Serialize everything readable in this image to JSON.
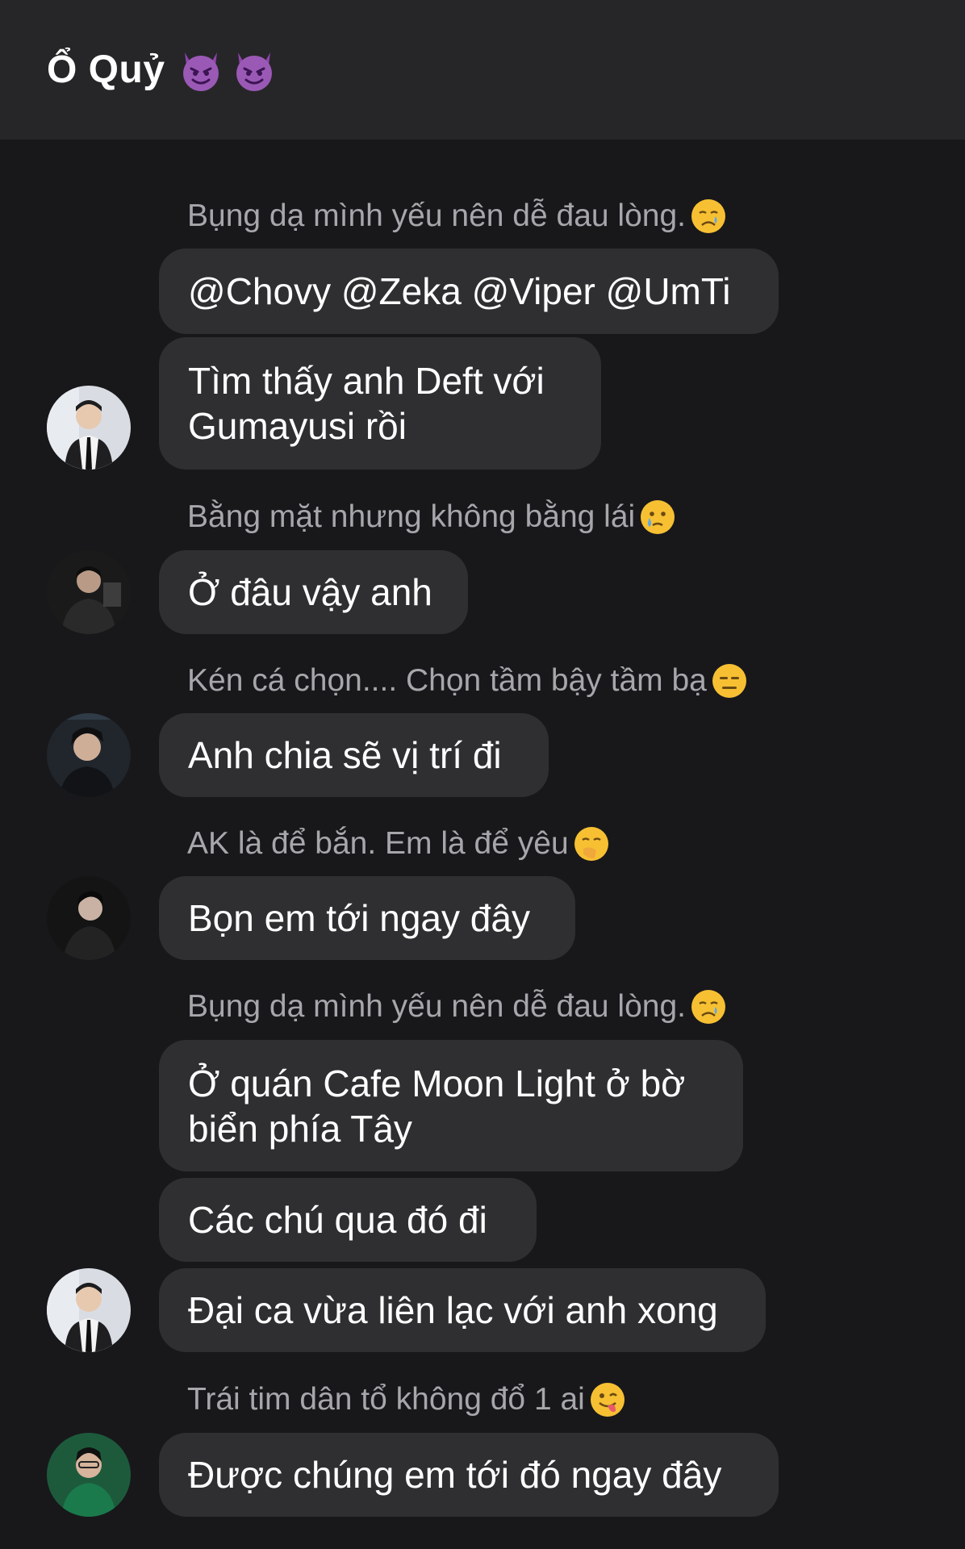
{
  "header": {
    "title": "Ổ Quỷ",
    "icons": [
      "devil-emoji-icon",
      "devil-emoji-icon"
    ]
  },
  "messages": [
    {
      "sender": "Bụng dạ mình yếu nên dễ đau lòng.",
      "sender_emoji": "crying-face-icon",
      "text": "@Chovy @Zeka @Viper @UmTi"
    },
    {
      "text": "Tìm thấy anh Deft với Gumayusi rồi"
    },
    {
      "sender": "Bằng mặt nhưng không bằng lái ",
      "sender_emoji": "sad-tear-face-icon",
      "text": "Ở đâu vậy anh"
    },
    {
      "sender": "Kén cá chọn.... Chọn tầm bậy tầm bạ",
      "sender_emoji": "expressionless-face-icon",
      "text": "Anh chia sẽ vị trí đi"
    },
    {
      "sender": "AK là để bắn. Em là để yêu",
      "sender_emoji": "face-with-hand-over-mouth-icon",
      "text": "Bọn em tới ngay đây"
    },
    {
      "sender": "Bụng dạ mình yếu nên dễ đau lòng.",
      "sender_emoji": "crying-face-icon",
      "text": "Ở quán Cafe Moon Light ở bờ biển phía Tây"
    },
    {
      "text": "Các chú qua đó đi"
    },
    {
      "text": "Đại ca vừa liên lạc với anh xong"
    },
    {
      "sender": "Trái tim dân tổ không đổ 1 ai",
      "sender_emoji": "winking-face-with-tongue-icon",
      "text": "Được chúng em tới đó ngay đây"
    }
  ],
  "colors": {
    "header_bg": "#262628",
    "chat_bg": "#18181b",
    "bubble_bg": "#2f2f32",
    "sender_text": "#a6a6ab"
  }
}
